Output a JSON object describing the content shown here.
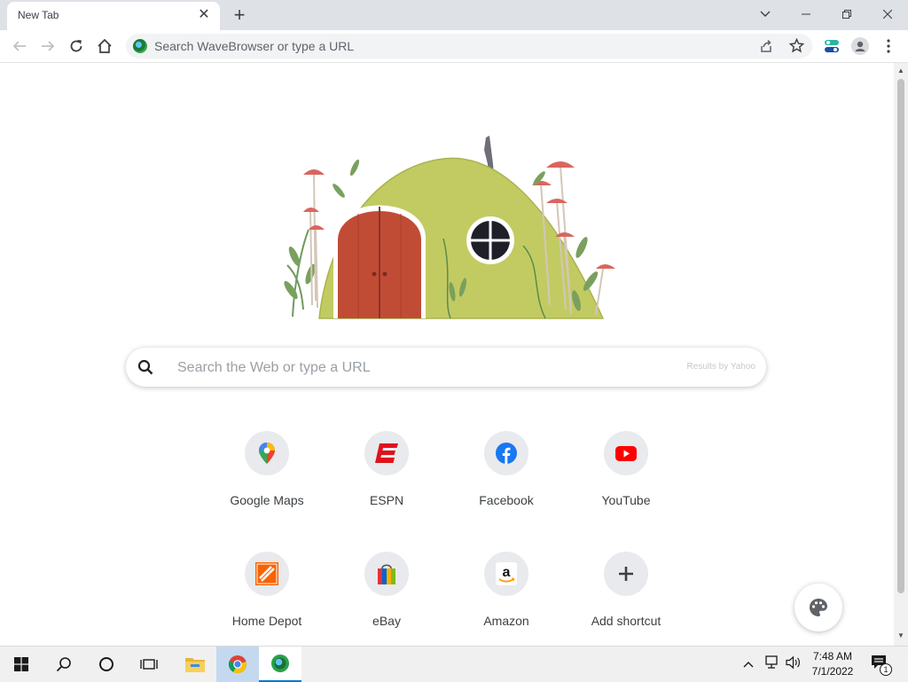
{
  "tab": {
    "title": "New Tab",
    "close_glyph": "✕"
  },
  "window_controls": {
    "list_glyph": "⌄",
    "minimize_glyph": "—",
    "restore_glyph": "❐",
    "close_glyph": "✕"
  },
  "toolbar": {
    "back_icon": "arrow-left",
    "forward_icon": "arrow-right",
    "reload_icon": "reload",
    "home_icon": "home",
    "omnibox_placeholder": "Search WaveBrowser or type a URL"
  },
  "search": {
    "placeholder": "Search the Web or type a URL",
    "attribution": "Results by Yahoo"
  },
  "shortcuts": [
    {
      "label": "Google Maps",
      "icon": "google-maps"
    },
    {
      "label": "ESPN",
      "icon": "espn"
    },
    {
      "label": "Facebook",
      "icon": "facebook"
    },
    {
      "label": "YouTube",
      "icon": "youtube"
    },
    {
      "label": "Home Depot",
      "icon": "home-depot"
    },
    {
      "label": "eBay",
      "icon": "ebay-bag"
    },
    {
      "label": "Amazon",
      "icon": "amazon"
    },
    {
      "label": "Add shortcut",
      "icon": "plus"
    }
  ],
  "taskbar": {
    "time": "7:48 AM",
    "date": "7/1/2022",
    "notification_count": "1"
  },
  "colors": {
    "espn": "#e0121b",
    "facebook": "#1877f2",
    "youtube": "#ff0000",
    "home_depot": "#f96302"
  }
}
